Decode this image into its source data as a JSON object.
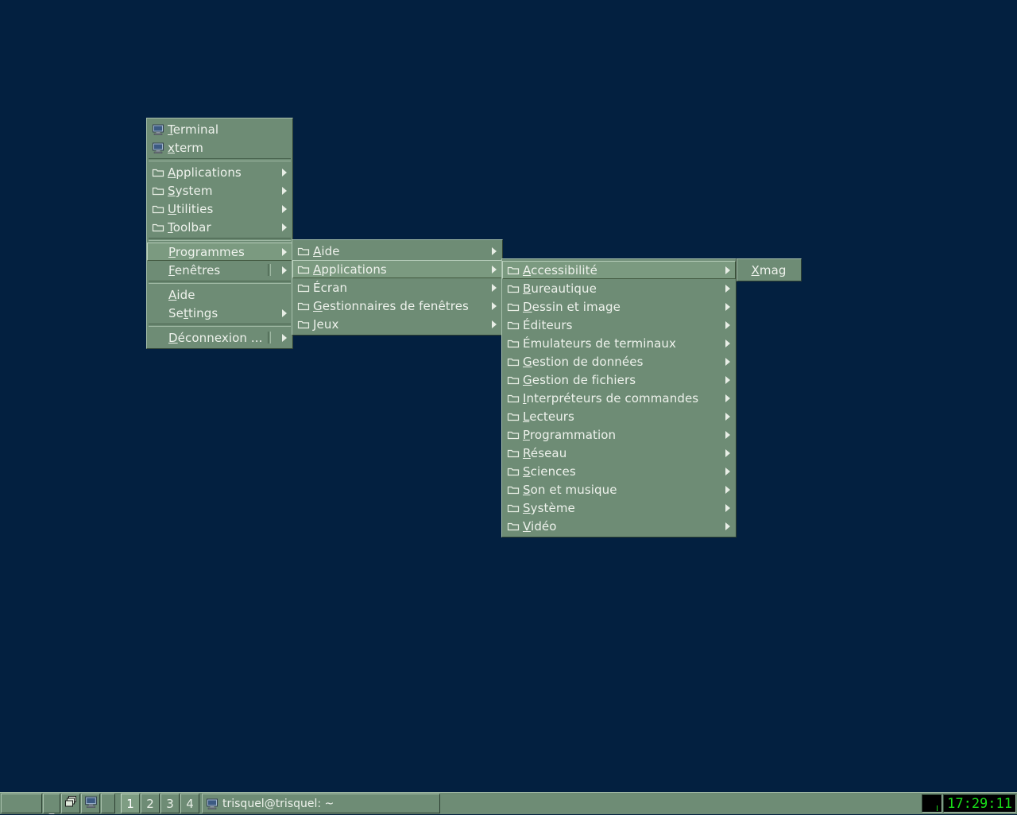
{
  "desktop": {
    "background_color": "#032040"
  },
  "theme": {
    "menu_background": "#6e8c75",
    "menu_text": "#eef2ec",
    "highlight_background": "#7b9a80",
    "clock_text": "#19e019",
    "clock_background": "#000000"
  },
  "menus": {
    "root": {
      "name": "root-menu",
      "items": [
        {
          "label": "Terminal",
          "mnemonic": "T",
          "icon": "terminal-icon",
          "submenu": false,
          "selected": false
        },
        {
          "label": "xterm",
          "mnemonic": "x",
          "icon": "terminal-icon",
          "submenu": false,
          "selected": false
        },
        {
          "separator": true
        },
        {
          "label": "Applications",
          "mnemonic": "A",
          "icon": "folder-icon",
          "submenu": true,
          "selected": false
        },
        {
          "label": "System",
          "mnemonic": "S",
          "icon": "folder-icon",
          "submenu": true,
          "selected": false
        },
        {
          "label": "Utilities",
          "mnemonic": "U",
          "icon": "folder-icon",
          "submenu": true,
          "selected": false
        },
        {
          "label": "Toolbar",
          "mnemonic": "T",
          "icon": "folder-icon",
          "submenu": true,
          "selected": false
        },
        {
          "separator": true
        },
        {
          "label": "Programmes",
          "mnemonic": "P",
          "icon": "none",
          "submenu": true,
          "selected": true
        },
        {
          "label": "Fenêtres",
          "mnemonic": "F",
          "icon": "none",
          "submenu": true,
          "selected": false,
          "divider": true
        },
        {
          "separator": true
        },
        {
          "label": "Aide",
          "mnemonic": "A",
          "icon": "none",
          "submenu": false,
          "selected": false
        },
        {
          "label": "Settings",
          "mnemonic": "t",
          "icon": "none",
          "submenu": true,
          "selected": false
        },
        {
          "separator": true
        },
        {
          "label": "Déconnexion ...",
          "mnemonic": "D",
          "icon": "none",
          "submenu": true,
          "selected": false,
          "divider": true
        }
      ]
    },
    "programmes": {
      "name": "programmes-menu",
      "items": [
        {
          "label": "Aide",
          "mnemonic": "A",
          "icon": "folder-icon",
          "submenu": true,
          "selected": false
        },
        {
          "label": "Applications",
          "mnemonic": "A",
          "icon": "folder-icon",
          "submenu": true,
          "selected": true
        },
        {
          "label": "Écran",
          "mnemonic": "",
          "icon": "folder-icon",
          "submenu": true,
          "selected": false
        },
        {
          "label": "Gestionnaires de fenêtres",
          "mnemonic": "G",
          "icon": "folder-icon",
          "submenu": true,
          "selected": false
        },
        {
          "label": "Jeux",
          "mnemonic": "J",
          "icon": "folder-icon",
          "submenu": true,
          "selected": false
        }
      ]
    },
    "applications": {
      "name": "applications-menu",
      "items": [
        {
          "label": "Accessibilité",
          "mnemonic": "A",
          "icon": "folder-icon",
          "submenu": true,
          "selected": true
        },
        {
          "label": "Bureautique",
          "mnemonic": "B",
          "icon": "folder-icon",
          "submenu": true,
          "selected": false
        },
        {
          "label": "Dessin et image",
          "mnemonic": "D",
          "icon": "folder-icon",
          "submenu": true,
          "selected": false
        },
        {
          "label": "Éditeurs",
          "mnemonic": "",
          "icon": "folder-icon",
          "submenu": true,
          "selected": false
        },
        {
          "label": "Émulateurs de terminaux",
          "mnemonic": "",
          "icon": "folder-icon",
          "submenu": true,
          "selected": false
        },
        {
          "label": "Gestion de données",
          "mnemonic": "G",
          "icon": "folder-icon",
          "submenu": true,
          "selected": false
        },
        {
          "label": "Gestion de fichiers",
          "mnemonic": "G",
          "icon": "folder-icon",
          "submenu": true,
          "selected": false
        },
        {
          "label": "Interpréteurs de commandes",
          "mnemonic": "I",
          "icon": "folder-icon",
          "submenu": true,
          "selected": false
        },
        {
          "label": "Lecteurs",
          "mnemonic": "L",
          "icon": "folder-icon",
          "submenu": true,
          "selected": false
        },
        {
          "label": "Programmation",
          "mnemonic": "P",
          "icon": "folder-icon",
          "submenu": true,
          "selected": false
        },
        {
          "label": "Réseau",
          "mnemonic": "R",
          "icon": "folder-icon",
          "submenu": true,
          "selected": false
        },
        {
          "label": "Sciences",
          "mnemonic": "S",
          "icon": "folder-icon",
          "submenu": true,
          "selected": false
        },
        {
          "label": "Son et musique",
          "mnemonic": "S",
          "icon": "folder-icon",
          "submenu": true,
          "selected": false
        },
        {
          "label": "Système",
          "mnemonic": "S",
          "icon": "folder-icon",
          "submenu": true,
          "selected": false
        },
        {
          "label": "Vidéo",
          "mnemonic": "V",
          "icon": "folder-icon",
          "submenu": true,
          "selected": false
        }
      ]
    },
    "accessibilite": {
      "name": "accessibilite-menu",
      "items": [
        {
          "label": "Xmag",
          "mnemonic": "X",
          "icon": "none",
          "submenu": false,
          "selected": false
        }
      ]
    }
  },
  "taskbar": {
    "start_button": "",
    "hide_button": "_",
    "windows_button": "windows-icon",
    "showdesktop_button": "showdesktop-icon",
    "workspaces": [
      {
        "label": "1",
        "active": true
      },
      {
        "label": "2",
        "active": false
      },
      {
        "label": "3",
        "active": false
      },
      {
        "label": "4",
        "active": false
      }
    ],
    "tasks": [
      {
        "label": "trisquel@trisquel: ~",
        "icon": "terminal-icon"
      }
    ],
    "clock": "17:29:11"
  }
}
